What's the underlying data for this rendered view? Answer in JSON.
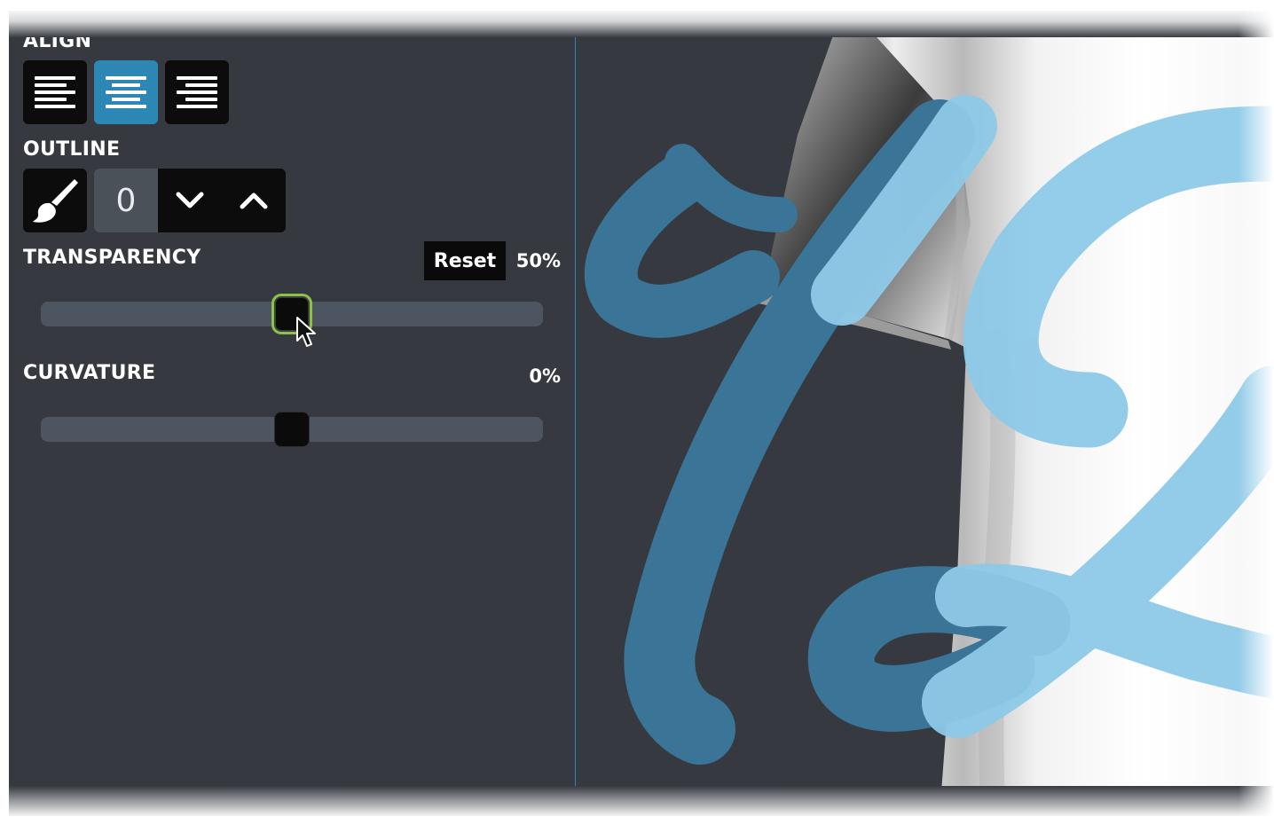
{
  "align": {
    "label": "ALIGN",
    "options": [
      "left",
      "center",
      "right"
    ],
    "selected": "center"
  },
  "outline": {
    "label": "OUTLINE",
    "value": "0"
  },
  "transparency": {
    "label": "TRANSPARENCY",
    "reset_label": "Reset",
    "value_text": "50%",
    "value": 50
  },
  "curvature": {
    "label": "CURVATURE",
    "value_text": "0%",
    "value": 0
  },
  "colors": {
    "panel_bg": "#363a40",
    "accent": "#2d87b4",
    "focus_ring": "#8dc24a",
    "design_ink": "#8ecae8"
  },
  "icons": {
    "outline_color": "paintbrush-icon",
    "decrease": "chevron-down-icon",
    "increase": "chevron-up-icon"
  }
}
